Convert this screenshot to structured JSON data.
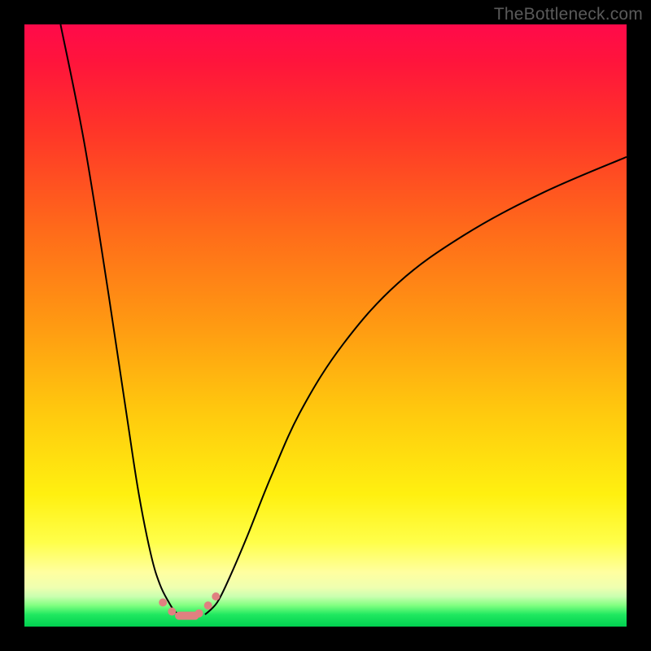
{
  "watermark_text": "TheBottleneck.com",
  "colors": {
    "frame": "#000000",
    "curve": "#000000",
    "markers": "#e08080",
    "gradient_top": "#ff0a4a",
    "gradient_bottom": "#00d050"
  },
  "chart_data": {
    "type": "line",
    "title": "",
    "xlabel": "",
    "ylabel": "",
    "xlim": [
      0,
      100
    ],
    "ylim": [
      0,
      100
    ],
    "note": "Two smooth curves descending from top to a common minimum near the bottom then rising. X expressed as percent of plot width, Y as percent of plot height (0 = bottom, 100 = top). Values read approximately from image pixels.",
    "series": [
      {
        "name": "left-curve",
        "x": [
          6,
          10,
          14,
          17,
          19,
          21,
          22.5,
          24,
          25,
          26
        ],
        "y": [
          100,
          80,
          55,
          35,
          22,
          12,
          7,
          4,
          2.5,
          2
        ]
      },
      {
        "name": "right-curve",
        "x": [
          30,
          32,
          34,
          37,
          41,
          46,
          53,
          62,
          73,
          86,
          100
        ],
        "y": [
          2,
          4,
          8,
          15,
          25,
          36,
          47,
          57,
          65,
          72,
          78
        ]
      }
    ],
    "markers": {
      "note": "Small salmon dots/segments clustered at the valley bottom.",
      "points": [
        {
          "x": 23.0,
          "y": 4.0
        },
        {
          "x": 24.5,
          "y": 2.5
        },
        {
          "x": 29.0,
          "y": 2.2
        },
        {
          "x": 30.5,
          "y": 3.5
        },
        {
          "x": 31.8,
          "y": 5.0
        }
      ],
      "thick_segment": {
        "x0": 25.0,
        "x1": 29.0,
        "y": 1.8
      }
    }
  }
}
